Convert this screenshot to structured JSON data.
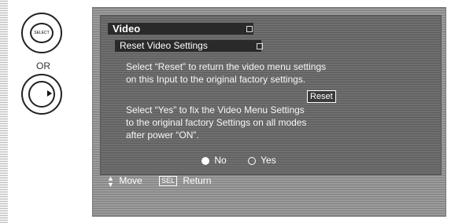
{
  "remote": {
    "select_button_label": "SELECT",
    "or_label": "OR"
  },
  "menu": {
    "title": "Video",
    "subtitle": "Reset Video Settings",
    "paragraph1": [
      "Select “Reset” to return the video menu settings",
      "on this Input to the original factory settings."
    ],
    "reset_label": "Reset",
    "paragraph2": [
      "Select “Yes” to fix the Video Menu Settings",
      "to the original factory Settings on all modes",
      "after power “ON”."
    ],
    "options": [
      {
        "label": "No",
        "selected": true
      },
      {
        "label": "Yes",
        "selected": false
      }
    ],
    "footer": {
      "move_label": "Move",
      "sel_key_label": "SEL",
      "return_label": "Return"
    }
  },
  "icons": {
    "select_button": "select-button-icon",
    "dpad": "dpad-right-icon",
    "updown": "up-down-arrows-icon"
  }
}
